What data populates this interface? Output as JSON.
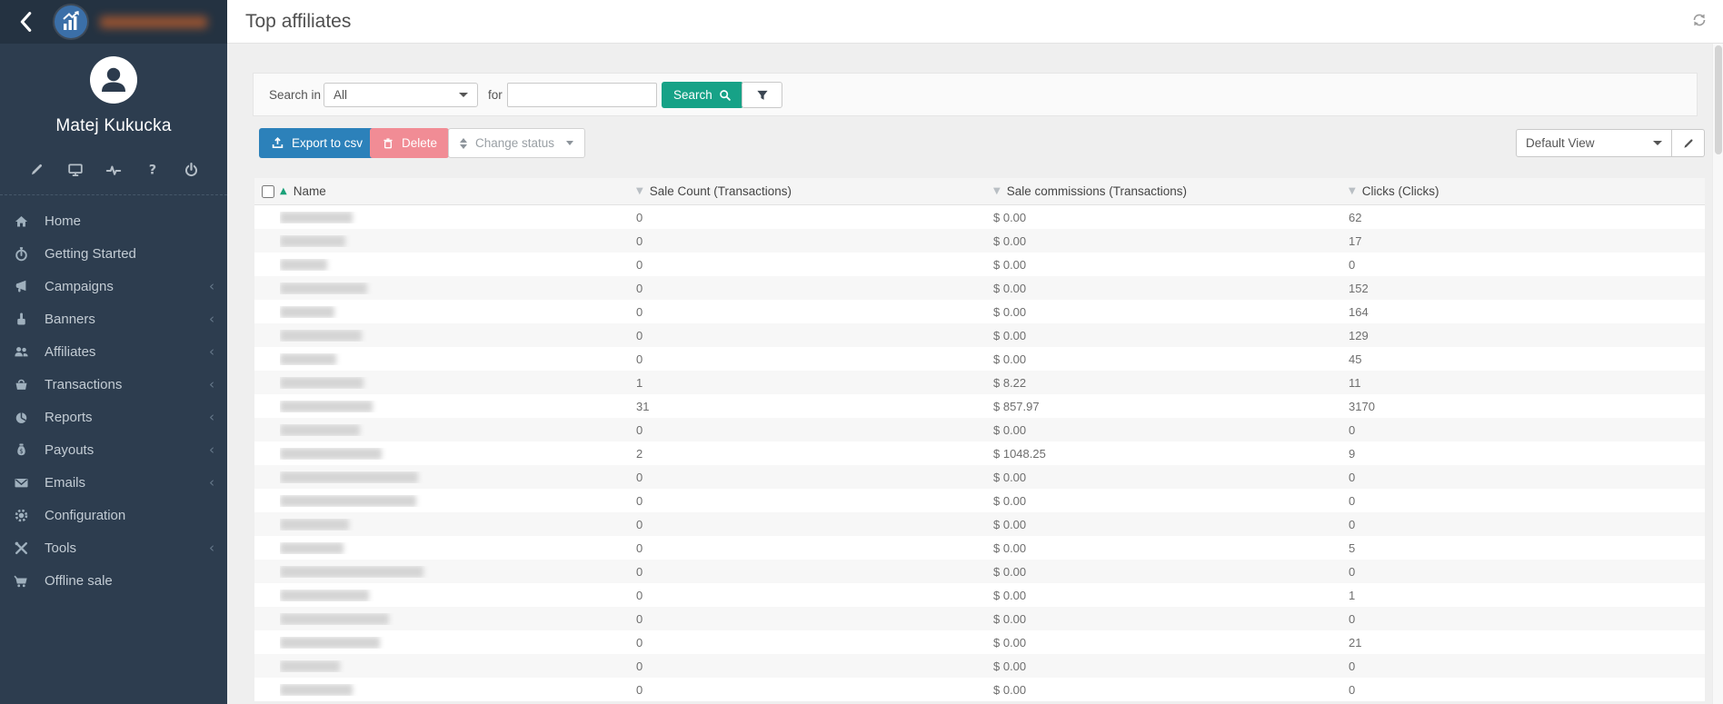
{
  "topbar": {
    "title": "Top affiliates"
  },
  "sidebar": {
    "user_name": "Matej Kukucka",
    "brand_name_redacted": true,
    "quick_actions": [
      {
        "icon": "pencil-icon"
      },
      {
        "icon": "monitor-icon"
      },
      {
        "icon": "pulse-icon"
      },
      {
        "icon": "help-icon"
      },
      {
        "icon": "power-icon"
      }
    ],
    "nav": [
      {
        "label": "Home",
        "icon": "home-icon",
        "expandable": false
      },
      {
        "label": "Getting Started",
        "icon": "stopwatch-icon",
        "expandable": false
      },
      {
        "label": "Campaigns",
        "icon": "megaphone-icon",
        "expandable": true
      },
      {
        "label": "Banners",
        "icon": "hand-icon",
        "expandable": true
      },
      {
        "label": "Affiliates",
        "icon": "users-icon",
        "expandable": true
      },
      {
        "label": "Transactions",
        "icon": "basket-icon",
        "expandable": true
      },
      {
        "label": "Reports",
        "icon": "pie-chart-icon",
        "expandable": true
      },
      {
        "label": "Payouts",
        "icon": "money-bag-icon",
        "expandable": true
      },
      {
        "label": "Emails",
        "icon": "envelope-icon",
        "expandable": true
      },
      {
        "label": "Configuration",
        "icon": "gear-icon",
        "expandable": false
      },
      {
        "label": "Tools",
        "icon": "tools-icon",
        "expandable": true
      },
      {
        "label": "Offline sale",
        "icon": "cart-icon",
        "expandable": false
      }
    ],
    "expand_chevron": "‹"
  },
  "filters": {
    "search_in_label": "Search in",
    "search_in_value": "All",
    "for_label": "for",
    "search_input_value": "",
    "search_button_label": "Search"
  },
  "toolbar": {
    "export_label": "Export to csv",
    "delete_label": "Delete",
    "change_status_label": "Change status",
    "view_selected": "Default View"
  },
  "table": {
    "sort": {
      "column": "Name",
      "direction": "ascending"
    },
    "headers": {
      "name": "Name",
      "sale_count": "Sale Count (Transactions)",
      "commissions": "Sale commissions (Transactions)",
      "clicks": "Clicks (Clicks)"
    },
    "rows": [
      {
        "sale_count": "0",
        "commission": "$ 0.00",
        "clicks": "62",
        "redacted_name_width": 80
      },
      {
        "sale_count": "0",
        "commission": "$ 0.00",
        "clicks": "17",
        "redacted_name_width": 72
      },
      {
        "sale_count": "0",
        "commission": "$ 0.00",
        "clicks": "0",
        "redacted_name_width": 52
      },
      {
        "sale_count": "0",
        "commission": "$ 0.00",
        "clicks": "152",
        "redacted_name_width": 96
      },
      {
        "sale_count": "0",
        "commission": "$ 0.00",
        "clicks": "164",
        "redacted_name_width": 60
      },
      {
        "sale_count": "0",
        "commission": "$ 0.00",
        "clicks": "129",
        "redacted_name_width": 90
      },
      {
        "sale_count": "0",
        "commission": "$ 0.00",
        "clicks": "45",
        "redacted_name_width": 62
      },
      {
        "sale_count": "1",
        "commission": "$ 8.22",
        "clicks": "11",
        "redacted_name_width": 92
      },
      {
        "sale_count": "31",
        "commission": "$ 857.97",
        "clicks": "3170",
        "redacted_name_width": 102
      },
      {
        "sale_count": "0",
        "commission": "$ 0.00",
        "clicks": "0",
        "redacted_name_width": 88
      },
      {
        "sale_count": "2",
        "commission": "$ 1048.25",
        "clicks": "9",
        "redacted_name_width": 112
      },
      {
        "sale_count": "0",
        "commission": "$ 0.00",
        "clicks": "0",
        "redacted_name_width": 152
      },
      {
        "sale_count": "0",
        "commission": "$ 0.00",
        "clicks": "0",
        "redacted_name_width": 150
      },
      {
        "sale_count": "0",
        "commission": "$ 0.00",
        "clicks": "0",
        "redacted_name_width": 76
      },
      {
        "sale_count": "0",
        "commission": "$ 0.00",
        "clicks": "5",
        "redacted_name_width": 70
      },
      {
        "sale_count": "0",
        "commission": "$ 0.00",
        "clicks": "0",
        "redacted_name_width": 158
      },
      {
        "sale_count": "0",
        "commission": "$ 0.00",
        "clicks": "1",
        "redacted_name_width": 98
      },
      {
        "sale_count": "0",
        "commission": "$ 0.00",
        "clicks": "0",
        "redacted_name_width": 120
      },
      {
        "sale_count": "0",
        "commission": "$ 0.00",
        "clicks": "21",
        "redacted_name_width": 110
      },
      {
        "sale_count": "0",
        "commission": "$ 0.00",
        "clicks": "0",
        "redacted_name_width": 66
      },
      {
        "sale_count": "0",
        "commission": "$ 0.00",
        "clicks": "0",
        "redacted_name_width": 80
      }
    ]
  },
  "colors": {
    "sidebar_bg": "#2d3d4f",
    "sidebar_top_bg": "#243241",
    "accent_blue": "#2c81ba",
    "search_green": "#17a287",
    "delete_pink": "#f18c95",
    "sort_green": "#1aa179",
    "logo_blue": "#3b6fa8",
    "zebra_row": "#f7f7f7"
  },
  "icons": {
    "sort_asc": "▲",
    "sort_desc": "▼"
  }
}
